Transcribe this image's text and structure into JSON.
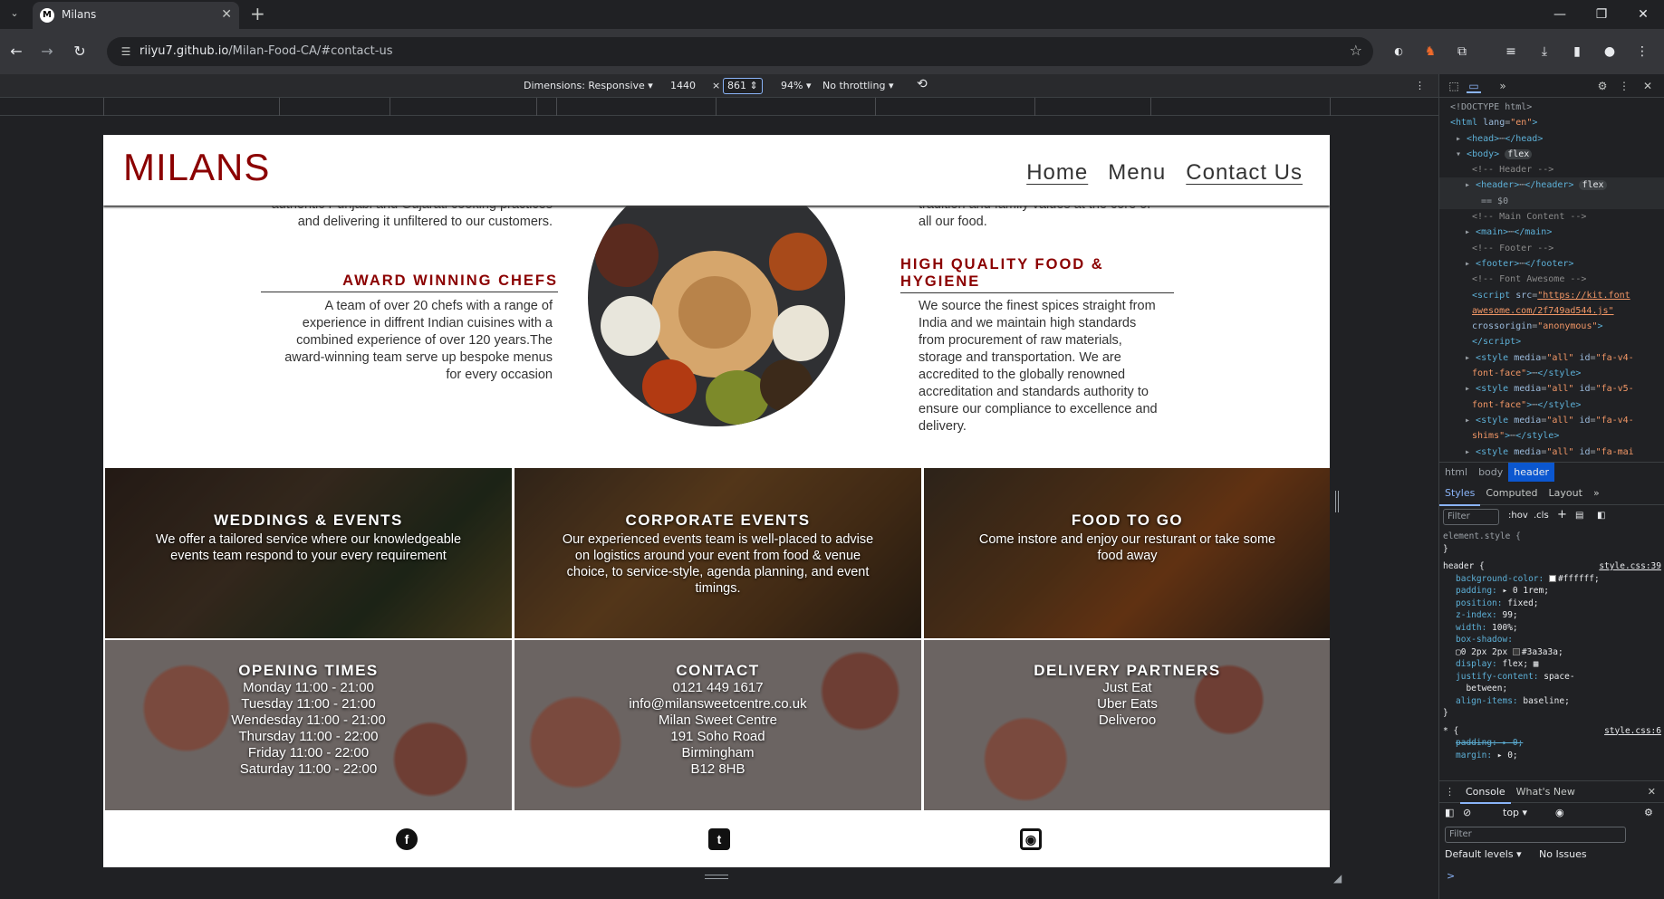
{
  "browser": {
    "tab_title": "Milans",
    "tab_favicon_letter": "M",
    "url_host": "riiyu7.github.io",
    "url_path": "/Milan-Food-CA/#contact-us",
    "new_tab_glyph": "+",
    "close_glyph": "✕"
  },
  "device_toolbar": {
    "dimensions_label": "Dimensions: Responsive",
    "width": "1440",
    "times": "×",
    "height": "861",
    "zoom": "94%",
    "throttling": "No throttling"
  },
  "site": {
    "logo": "MILANS",
    "nav": [
      "Home",
      "Menu",
      "Contact Us"
    ],
    "about": {
      "left_intro": "authentic Punjabi and Gujarati cooking practices and delivering it unfiltered to our customers.",
      "left_heading": "AWARD WINNING CHEFS",
      "left_body": "A team of over 20 chefs with a range of experience in diffrent Indian cuisines with a combined experience of over 120 years.The award-winning team serve up bespoke menus for every occasion",
      "right_intro": "tradition and family values at the core of all our food.",
      "right_heading": "HIGH QUALITY FOOD & HYGIENE",
      "right_body": "We source the finest spices straight from India and we maintain high standards from procurement of raw materials, storage and transportation. We are accredited to the globally renowned accreditation and standards authority to ensure our compliance to excellence and delivery."
    },
    "services": [
      {
        "title": "WEDDINGS & EVENTS",
        "text": "We offer a tailored service where our knowledgeable events team respond to your every requirement"
      },
      {
        "title": "CORPORATE EVENTS",
        "text": "Our experienced events team is well-placed to advise on logistics around your event from food & venue choice, to service-style, agenda planning, and event timings."
      },
      {
        "title": "FOOD TO GO",
        "text": "Come instore and enjoy our resturant or take some food away"
      }
    ],
    "info": [
      {
        "title": "OPENING TIMES",
        "lines": [
          "Monday 11:00 - 21:00",
          "Tuesday 11:00 - 21:00",
          "Wendesday 11:00 - 21:00",
          "Thursday 11:00 - 22:00",
          "Friday 11:00 - 22:00",
          "Saturday 11:00 - 22:00"
        ]
      },
      {
        "title": "CONTACT",
        "lines": [
          "0121 449 1617",
          "info@milansweetcentre.co.uk",
          "Milan Sweet Centre",
          "191 Soho Road",
          "Birmingham",
          "B12 8HB"
        ]
      },
      {
        "title": "DELIVERY PARTNERS",
        "lines": [
          "Just Eat",
          "Uber Eats",
          "Deliveroo"
        ]
      }
    ],
    "social_icons": [
      "facebook-icon",
      "twitter-icon",
      "instagram-icon"
    ]
  },
  "devtools": {
    "breadcrumbs": [
      "html",
      "body",
      "header"
    ],
    "subtabs": [
      "Styles",
      "Computed",
      "Layout"
    ],
    "filter_placeholder": "Filter",
    "hov": ":hov",
    "cls": ".cls",
    "drawer_tabs": [
      "Console",
      "What's New"
    ],
    "console_context": "top",
    "console_filter_placeholder": "Filter",
    "default_levels": "Default levels",
    "no_issues": "No Issues",
    "prompt": ">"
  },
  "colors": {
    "brand": "#8b0000",
    "header_bg": "#ffffff",
    "header_shadow": "#3a3a3a",
    "devtools_accent": "#8ab4f8"
  }
}
